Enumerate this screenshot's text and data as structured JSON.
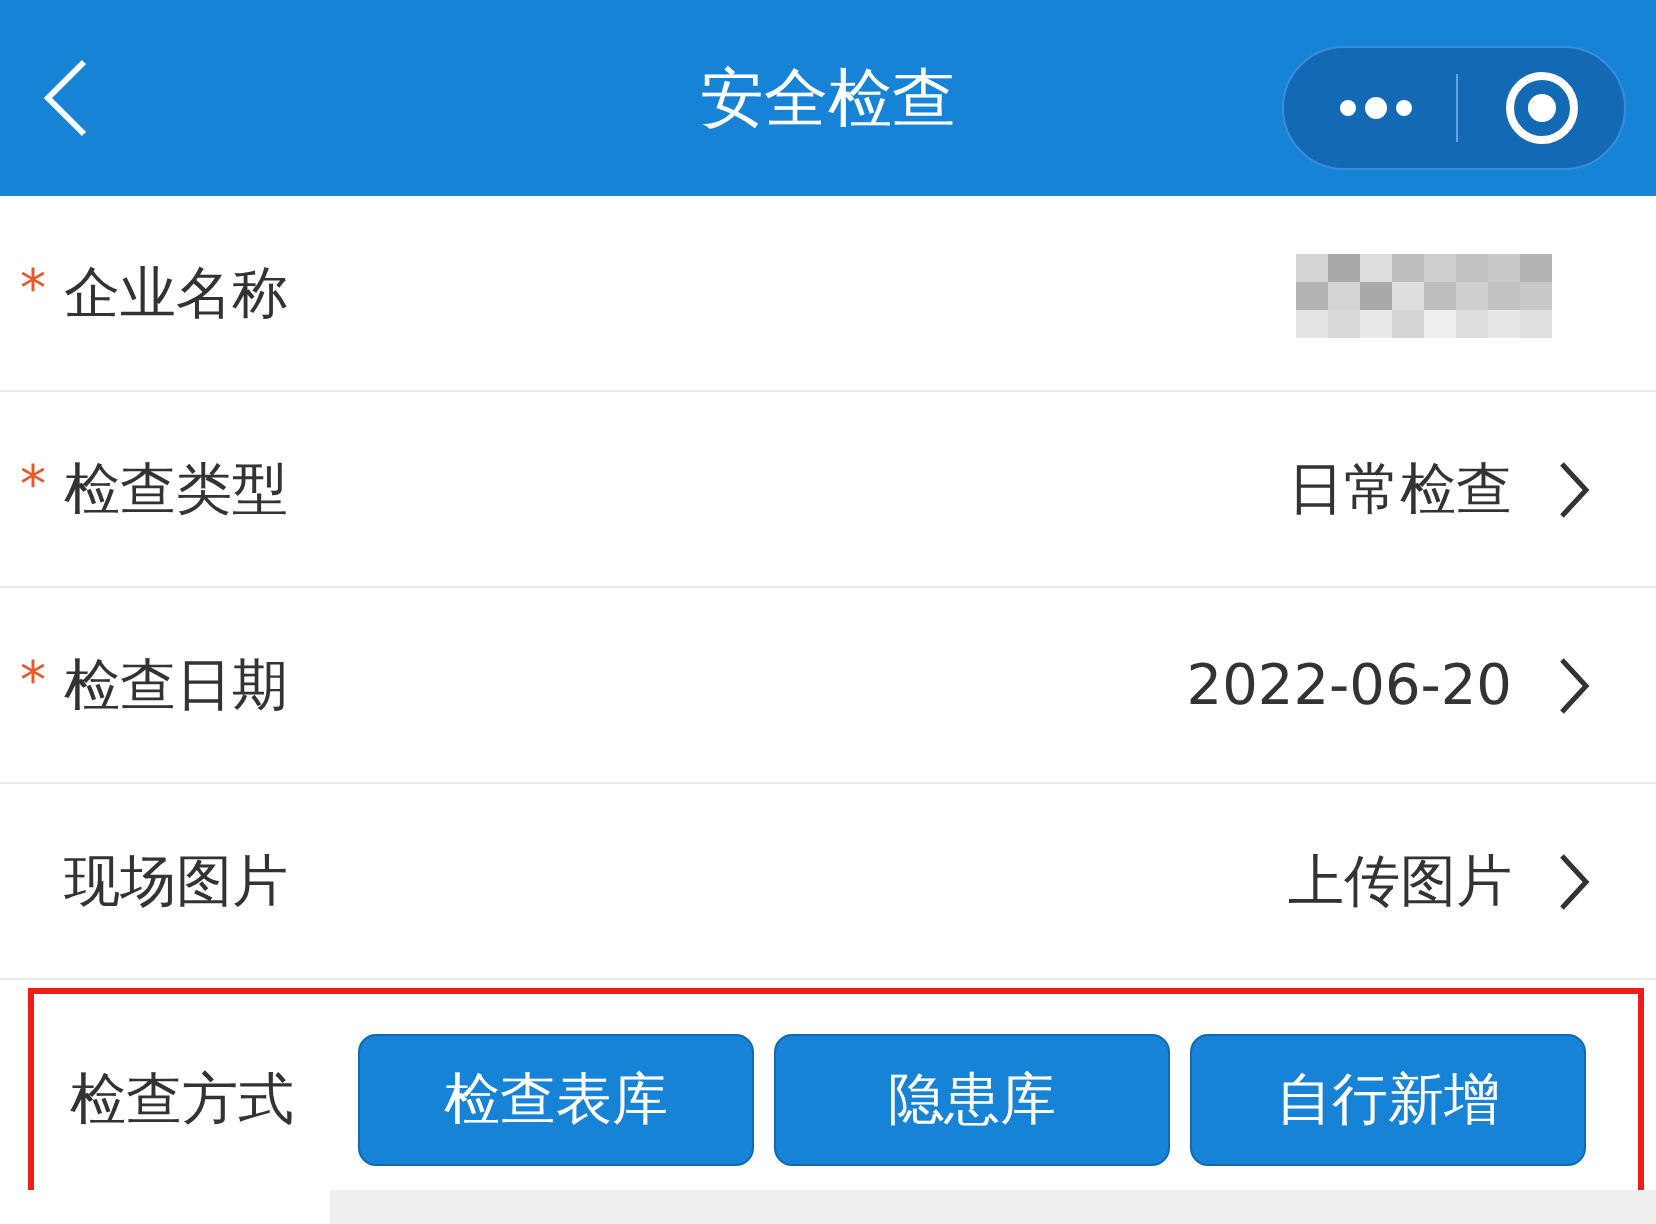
{
  "nav_bar": {
    "title": "安全检查"
  },
  "fields": [
    {
      "label": "企业名称",
      "required": true,
      "kind": "masked"
    },
    {
      "label": "检查类型",
      "required": true,
      "kind": "select",
      "value": "日常检查"
    },
    {
      "label": "检查日期",
      "required": true,
      "kind": "select",
      "value": "2022-06-20"
    },
    {
      "label": "现场图片",
      "required": false,
      "kind": "select",
      "value": "上传图片"
    }
  ],
  "required_mark": "*",
  "method_row": {
    "label": "检查方式",
    "highlighted": true,
    "buttons": [
      "检查表库",
      "隐患库",
      "自行新增"
    ]
  }
}
